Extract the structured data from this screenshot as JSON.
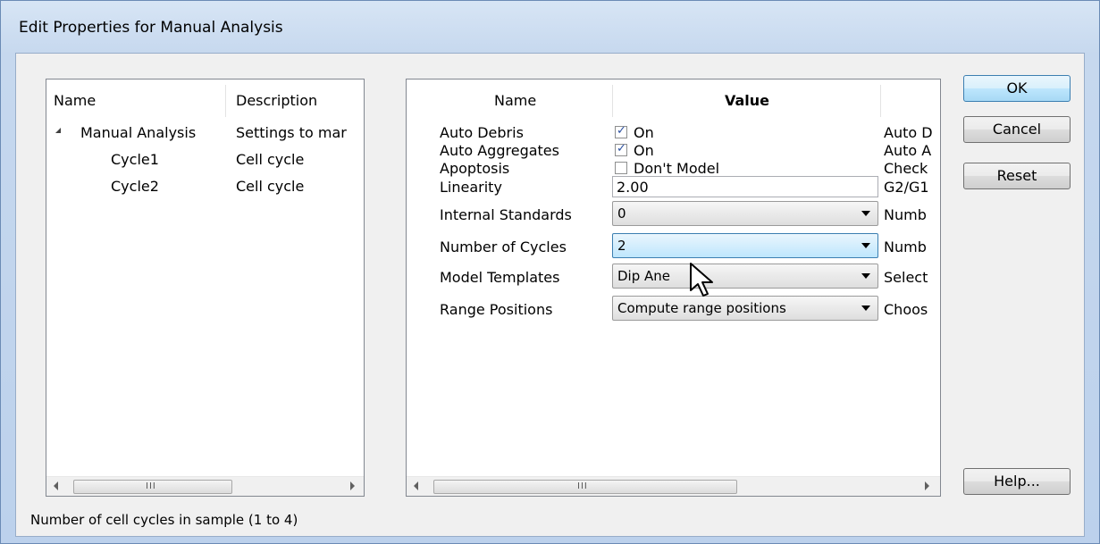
{
  "window": {
    "title": "Edit Properties for Manual Analysis"
  },
  "left_pane": {
    "columns": [
      "Name",
      "Description"
    ],
    "rows": [
      {
        "name": "Manual Analysis",
        "description": "Settings to mar",
        "expanded": true
      },
      {
        "name": "Cycle1",
        "description": "Cell cycle"
      },
      {
        "name": "Cycle2",
        "description": "Cell cycle"
      }
    ],
    "scroll_grip": "III"
  },
  "right_pane": {
    "columns": [
      "Name",
      "Value",
      ""
    ],
    "rows": [
      {
        "name": "Auto Debris",
        "control": "checkbox",
        "checked": true,
        "value": "On",
        "description": "Auto D"
      },
      {
        "name": "Auto Aggregates",
        "control": "checkbox",
        "checked": true,
        "value": "On",
        "description": "Auto A"
      },
      {
        "name": "Apoptosis",
        "control": "checkbox",
        "checked": false,
        "value": "Don't Model",
        "description": "Check"
      },
      {
        "name": "Linearity",
        "control": "text",
        "value": "2.00",
        "description": "G2/G1"
      },
      {
        "name": "Internal Standards",
        "control": "combo",
        "value": "0",
        "description": "Numb"
      },
      {
        "name": "Number of Cycles",
        "control": "combo",
        "value": "2",
        "description": "Numb",
        "active": true
      },
      {
        "name": "Model Templates",
        "control": "combo",
        "value": "Dip Ane",
        "description": "Select"
      },
      {
        "name": "Range Positions",
        "control": "combo",
        "value": "Compute range positions",
        "description": "Choos"
      }
    ],
    "scroll_grip": "III"
  },
  "buttons": {
    "ok": "OK",
    "cancel": "Cancel",
    "reset": "Reset",
    "help": "Help..."
  },
  "status_text": "Number of cell cycles in sample (1 to 4)",
  "icons": {
    "checkmark": "checkmark-icon",
    "cursor": "mouse-pointer-icon"
  },
  "colors": {
    "title_gradient_top": "#d7e5f5",
    "active_combo": "#bee6fd",
    "checkmark": "#2a4fa0"
  }
}
